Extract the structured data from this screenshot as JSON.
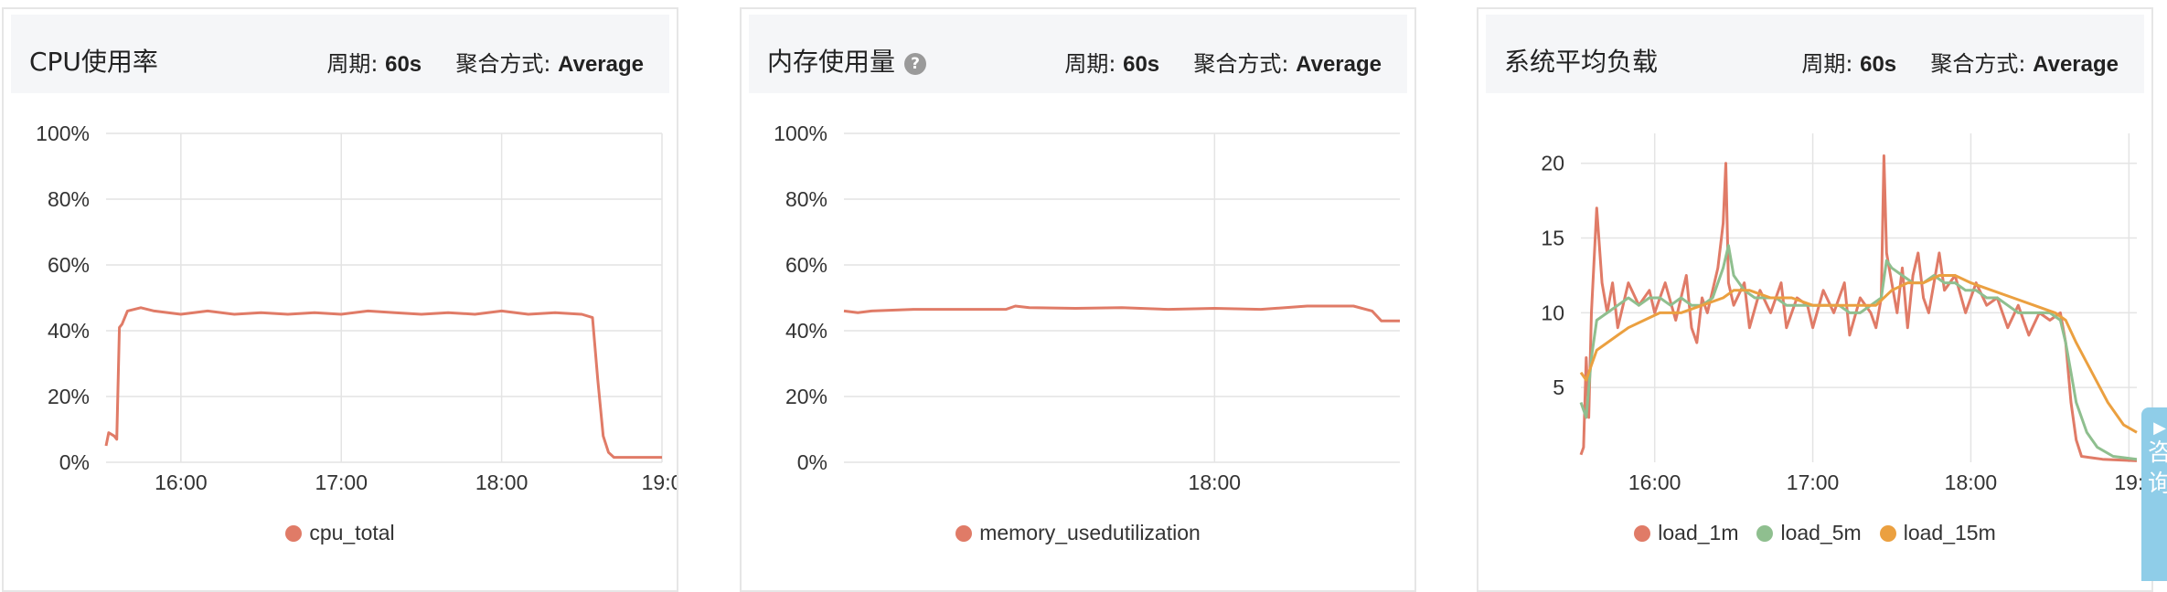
{
  "panels": [
    {
      "title": "CPU使用率",
      "has_help": false,
      "period_label": "周期:",
      "period_value": "60s",
      "agg_label": "聚合方式:",
      "agg_value": "Average"
    },
    {
      "title": "内存使用量",
      "has_help": true,
      "help_glyph": "?",
      "period_label": "周期:",
      "period_value": "60s",
      "agg_label": "聚合方式:",
      "agg_value": "Average"
    },
    {
      "title": "系统平均负载",
      "has_help": false,
      "period_label": "周期:",
      "period_value": "60s",
      "agg_label": "聚合方式:",
      "agg_value": "Average"
    }
  ],
  "side_widget": {
    "icon": "chat-icon",
    "chars": [
      "咨",
      "询"
    ]
  },
  "chart_data": [
    {
      "type": "line",
      "title": "",
      "ylim": [
        0,
        100
      ],
      "yticks": [
        "100%",
        "80%",
        "60%",
        "40%",
        "20%",
        "0%"
      ],
      "xlim": [
        "15:32",
        "19:00"
      ],
      "xticks": [
        "16:00",
        "17:00",
        "18:00",
        "19:0"
      ],
      "grid": true,
      "legend_placement": "bottom-center",
      "series": [
        {
          "name": "cpu_total",
          "color": "#e07b67",
          "points": [
            [
              "15:32",
              5
            ],
            [
              "15:33",
              9
            ],
            [
              "15:35",
              8
            ],
            [
              "15:36",
              7
            ],
            [
              "15:37",
              41
            ],
            [
              "15:38",
              42
            ],
            [
              "15:40",
              46
            ],
            [
              "15:45",
              47
            ],
            [
              "15:50",
              46
            ],
            [
              "16:00",
              45
            ],
            [
              "16:10",
              46
            ],
            [
              "16:20",
              45
            ],
            [
              "16:30",
              45.5
            ],
            [
              "16:40",
              45
            ],
            [
              "16:50",
              45.5
            ],
            [
              "17:00",
              45
            ],
            [
              "17:10",
              46
            ],
            [
              "17:20",
              45.5
            ],
            [
              "17:30",
              45
            ],
            [
              "17:40",
              45.5
            ],
            [
              "17:50",
              45
            ],
            [
              "18:00",
              46
            ],
            [
              "18:10",
              45
            ],
            [
              "18:20",
              45.5
            ],
            [
              "18:30",
              45
            ],
            [
              "18:34",
              44
            ],
            [
              "18:36",
              25
            ],
            [
              "18:38",
              8
            ],
            [
              "18:40",
              3
            ],
            [
              "18:42",
              1.5
            ],
            [
              "18:50",
              1.5
            ],
            [
              "19:00",
              1.5
            ]
          ]
        }
      ]
    },
    {
      "type": "line",
      "title": "",
      "ylim": [
        0,
        100
      ],
      "yticks": [
        "100%",
        "80%",
        "60%",
        "40%",
        "20%",
        "0%"
      ],
      "xlim": [
        "16:40",
        "18:40"
      ],
      "xticks": [
        "18:00"
      ],
      "grid": true,
      "legend_placement": "bottom-center",
      "series": [
        {
          "name": "memory_usedutilization",
          "color": "#e07b67",
          "points": [
            [
              "16:40",
              46
            ],
            [
              "16:43",
              45.5
            ],
            [
              "16:46",
              46
            ],
            [
              "16:55",
              46.5
            ],
            [
              "17:05",
              46.5
            ],
            [
              "17:15",
              46.5
            ],
            [
              "17:17",
              47.5
            ],
            [
              "17:20",
              47
            ],
            [
              "17:30",
              46.8
            ],
            [
              "17:40",
              47
            ],
            [
              "17:50",
              46.5
            ],
            [
              "18:00",
              46.8
            ],
            [
              "18:10",
              46.5
            ],
            [
              "18:20",
              47.5
            ],
            [
              "18:30",
              47.5
            ],
            [
              "18:34",
              46
            ],
            [
              "18:36",
              43
            ],
            [
              "18:40",
              43
            ]
          ]
        }
      ]
    },
    {
      "type": "line",
      "title": "",
      "ylim": [
        0,
        22
      ],
      "yticks": [
        "20",
        "15",
        "10",
        "5"
      ],
      "xlim": [
        "15:32",
        "19:03"
      ],
      "xticks": [
        "16:00",
        "17:00",
        "18:00",
        "19:"
      ],
      "grid": true,
      "legend_placement": "bottom-center",
      "series": [
        {
          "name": "load_1m",
          "color": "#e07b67",
          "points": [
            [
              "15:32",
              0.5
            ],
            [
              "15:33",
              1
            ],
            [
              "15:34",
              7
            ],
            [
              "15:35",
              3
            ],
            [
              "15:36",
              10
            ],
            [
              "15:38",
              17
            ],
            [
              "15:40",
              12
            ],
            [
              "15:42",
              10
            ],
            [
              "15:44",
              12
            ],
            [
              "15:46",
              9
            ],
            [
              "15:50",
              12
            ],
            [
              "15:54",
              10.5
            ],
            [
              "15:58",
              11.5
            ],
            [
              "16:00",
              10
            ],
            [
              "16:04",
              12
            ],
            [
              "16:08",
              9.5
            ],
            [
              "16:12",
              12.5
            ],
            [
              "16:14",
              9
            ],
            [
              "16:16",
              8
            ],
            [
              "16:18",
              11
            ],
            [
              "16:20",
              10
            ],
            [
              "16:24",
              13
            ],
            [
              "16:26",
              16
            ],
            [
              "16:27",
              20
            ],
            [
              "16:28",
              12
            ],
            [
              "16:30",
              10.5
            ],
            [
              "16:34",
              12
            ],
            [
              "16:36",
              9
            ],
            [
              "16:40",
              11.5
            ],
            [
              "16:44",
              10
            ],
            [
              "16:48",
              12
            ],
            [
              "16:50",
              9
            ],
            [
              "16:54",
              11
            ],
            [
              "16:58",
              10.5
            ],
            [
              "17:00",
              9
            ],
            [
              "17:04",
              11.5
            ],
            [
              "17:08",
              10
            ],
            [
              "17:12",
              12
            ],
            [
              "17:14",
              8.5
            ],
            [
              "17:18",
              11
            ],
            [
              "17:22",
              10
            ],
            [
              "17:24",
              9
            ],
            [
              "17:26",
              11
            ],
            [
              "17:27",
              20.5
            ],
            [
              "17:28",
              14
            ],
            [
              "17:30",
              12
            ],
            [
              "17:32",
              10
            ],
            [
              "17:34",
              13
            ],
            [
              "17:36",
              9
            ],
            [
              "17:38",
              12.5
            ],
            [
              "17:40",
              14
            ],
            [
              "17:42",
              11
            ],
            [
              "17:44",
              10
            ],
            [
              "17:48",
              14
            ],
            [
              "17:50",
              11.5
            ],
            [
              "17:54",
              12.5
            ],
            [
              "17:58",
              10
            ],
            [
              "18:02",
              12
            ],
            [
              "18:06",
              10.5
            ],
            [
              "18:10",
              11
            ],
            [
              "18:14",
              9
            ],
            [
              "18:18",
              10.5
            ],
            [
              "18:22",
              8.5
            ],
            [
              "18:26",
              10
            ],
            [
              "18:30",
              9.5
            ],
            [
              "18:34",
              10
            ],
            [
              "18:36",
              8
            ],
            [
              "18:38",
              4
            ],
            [
              "18:40",
              1.5
            ],
            [
              "18:42",
              0.4
            ],
            [
              "18:46",
              0.3
            ],
            [
              "18:50",
              0.2
            ],
            [
              "19:03",
              0.1
            ]
          ]
        },
        {
          "name": "load_5m",
          "color": "#8fbf8f",
          "points": [
            [
              "15:32",
              4
            ],
            [
              "15:33",
              3.5
            ],
            [
              "15:34",
              3
            ],
            [
              "15:36",
              7
            ],
            [
              "15:38",
              9.5
            ],
            [
              "15:42",
              10
            ],
            [
              "15:46",
              10.5
            ],
            [
              "15:50",
              11
            ],
            [
              "15:54",
              10.5
            ],
            [
              "15:58",
              11
            ],
            [
              "16:02",
              11
            ],
            [
              "16:06",
              10.5
            ],
            [
              "16:10",
              11
            ],
            [
              "16:14",
              10.5
            ],
            [
              "16:18",
              10.5
            ],
            [
              "16:22",
              11
            ],
            [
              "16:26",
              13
            ],
            [
              "16:28",
              14.5
            ],
            [
              "16:30",
              12.5
            ],
            [
              "16:34",
              11.5
            ],
            [
              "16:38",
              11
            ],
            [
              "16:42",
              11
            ],
            [
              "16:46",
              11
            ],
            [
              "16:50",
              10.5
            ],
            [
              "16:54",
              10.5
            ],
            [
              "16:58",
              10.5
            ],
            [
              "17:02",
              10.5
            ],
            [
              "17:06",
              10.5
            ],
            [
              "17:10",
              10.5
            ],
            [
              "17:14",
              10
            ],
            [
              "17:18",
              10
            ],
            [
              "17:22",
              10.5
            ],
            [
              "17:26",
              11
            ],
            [
              "17:28",
              13.5
            ],
            [
              "17:30",
              13
            ],
            [
              "17:34",
              12.5
            ],
            [
              "17:38",
              12
            ],
            [
              "17:42",
              12
            ],
            [
              "17:46",
              12.5
            ],
            [
              "17:50",
              12
            ],
            [
              "17:54",
              12
            ],
            [
              "17:58",
              11.5
            ],
            [
              "18:02",
              11.5
            ],
            [
              "18:06",
              11
            ],
            [
              "18:10",
              11
            ],
            [
              "18:14",
              10.5
            ],
            [
              "18:18",
              10
            ],
            [
              "18:22",
              10
            ],
            [
              "18:26",
              10
            ],
            [
              "18:30",
              10
            ],
            [
              "18:34",
              9.5
            ],
            [
              "18:36",
              8
            ],
            [
              "18:38",
              6
            ],
            [
              "18:40",
              4
            ],
            [
              "18:44",
              2
            ],
            [
              "18:48",
              1
            ],
            [
              "18:54",
              0.4
            ],
            [
              "19:03",
              0.2
            ]
          ]
        },
        {
          "name": "load_15m",
          "color": "#eba040",
          "points": [
            [
              "15:32",
              6
            ],
            [
              "15:34",
              5.5
            ],
            [
              "15:36",
              6.5
            ],
            [
              "15:38",
              7.5
            ],
            [
              "15:42",
              8
            ],
            [
              "15:46",
              8.5
            ],
            [
              "15:50",
              9
            ],
            [
              "15:56",
              9.5
            ],
            [
              "16:02",
              10
            ],
            [
              "16:10",
              10
            ],
            [
              "16:18",
              10.5
            ],
            [
              "16:26",
              11
            ],
            [
              "16:30",
              11.5
            ],
            [
              "16:36",
              11.5
            ],
            [
              "16:44",
              11
            ],
            [
              "16:52",
              11
            ],
            [
              "17:00",
              10.5
            ],
            [
              "17:08",
              10.5
            ],
            [
              "17:16",
              10.5
            ],
            [
              "17:24",
              10.5
            ],
            [
              "17:30",
              11.5
            ],
            [
              "17:36",
              12
            ],
            [
              "17:42",
              12
            ],
            [
              "17:48",
              12.5
            ],
            [
              "17:54",
              12.5
            ],
            [
              "18:00",
              12
            ],
            [
              "18:08",
              11.5
            ],
            [
              "18:16",
              11
            ],
            [
              "18:24",
              10.5
            ],
            [
              "18:32",
              10
            ],
            [
              "18:36",
              9.5
            ],
            [
              "18:40",
              8
            ],
            [
              "18:46",
              6
            ],
            [
              "18:52",
              4
            ],
            [
              "18:58",
              2.5
            ],
            [
              "19:03",
              2
            ]
          ]
        }
      ]
    }
  ]
}
